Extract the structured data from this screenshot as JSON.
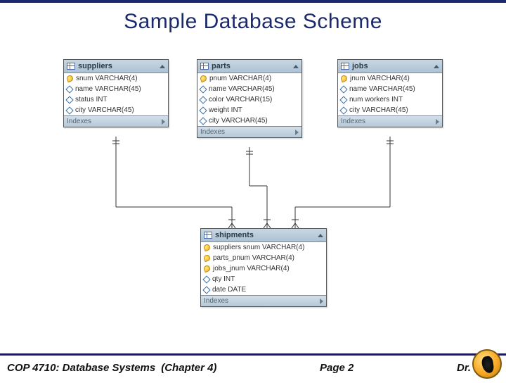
{
  "title": "Sample Database Scheme",
  "tables": {
    "suppliers": {
      "name": "suppliers",
      "footer": "Indexes",
      "rows": [
        {
          "icon": "key",
          "text": "snum VARCHAR(4)"
        },
        {
          "icon": "diamond",
          "text": "name VARCHAR(45)"
        },
        {
          "icon": "diamond",
          "text": "status INT"
        },
        {
          "icon": "diamond",
          "text": "city VARCHAR(45)"
        }
      ]
    },
    "parts": {
      "name": "parts",
      "footer": "Indexes",
      "rows": [
        {
          "icon": "key",
          "text": "pnum VARCHAR(4)"
        },
        {
          "icon": "diamond",
          "text": "name VARCHAR(45)"
        },
        {
          "icon": "diamond",
          "text": "color VARCHAR(15)"
        },
        {
          "icon": "diamond",
          "text": "weight INT"
        },
        {
          "icon": "diamond",
          "text": "city VARCHAR(45)"
        }
      ]
    },
    "jobs": {
      "name": "jobs",
      "footer": "Indexes",
      "rows": [
        {
          "icon": "key",
          "text": "jnum VARCHAR(4)"
        },
        {
          "icon": "diamond",
          "text": "name VARCHAR(45)"
        },
        {
          "icon": "diamond",
          "text": "num workers INT"
        },
        {
          "icon": "diamond",
          "text": "city VARCHAR(45)"
        }
      ]
    },
    "shipments": {
      "name": "shipments",
      "footer": "Indexes",
      "rows": [
        {
          "icon": "key",
          "text": "suppliers snum VARCHAR(4)"
        },
        {
          "icon": "key",
          "text": "parts_pnum VARCHAR(4)"
        },
        {
          "icon": "key",
          "text": "jobs_jnum VARCHAR(4)"
        },
        {
          "icon": "diamond",
          "text": "qty INT"
        },
        {
          "icon": "diamond",
          "text": "date DATE"
        }
      ]
    }
  },
  "footer": {
    "course": "COP 4710: Database Systems",
    "chapter": "(Chapter 4)",
    "page": "Page 2",
    "author": "Dr."
  }
}
